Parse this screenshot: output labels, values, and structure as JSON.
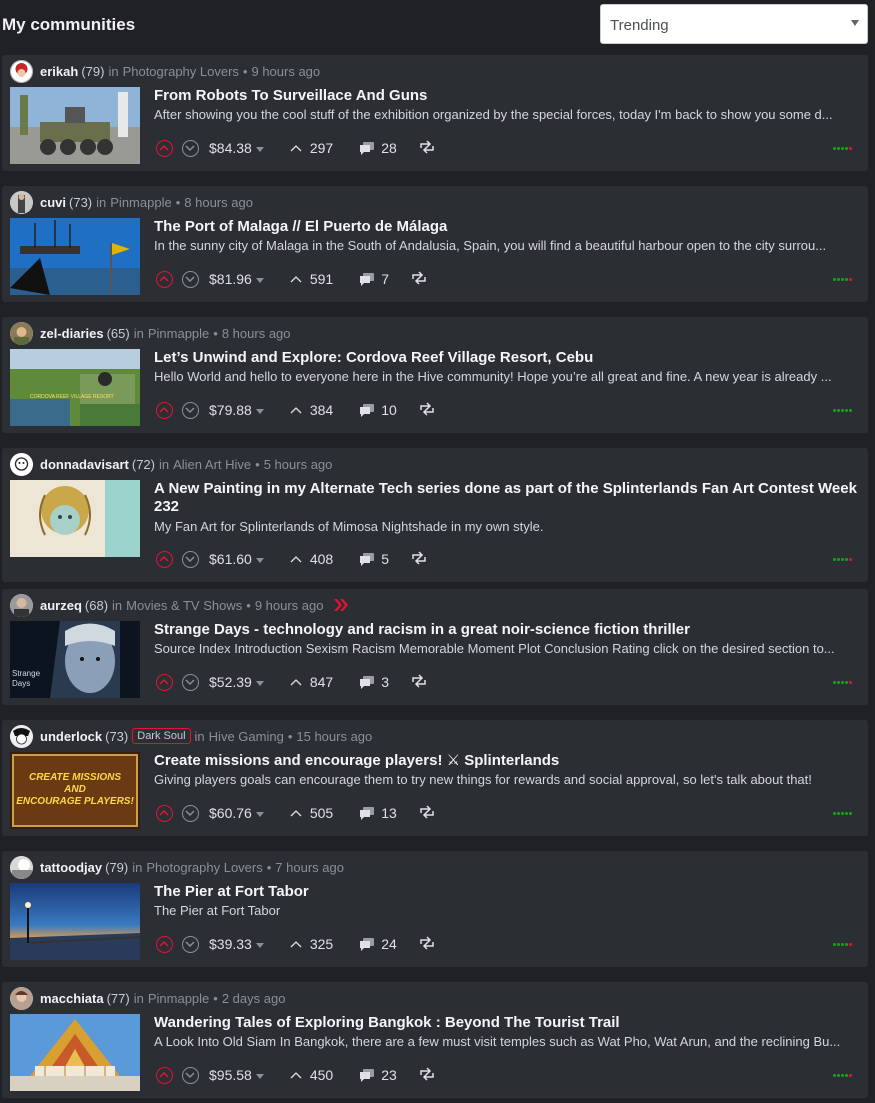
{
  "header": {
    "title": "My communities",
    "sort_value": "Trending"
  },
  "posts": [
    {
      "author": "erikah",
      "rep": "(79)",
      "in": "in",
      "community": "Photography Lovers",
      "time": "9 hours ago",
      "title": "From Robots To Surveillace And Guns",
      "summary": "After showing you the cool stuff of the exhibition organized by the special forces, today I'm back to show you some d...",
      "payout": "$84.38",
      "votes": "297",
      "comments": "28",
      "badge": ""
    },
    {
      "author": "cuvi",
      "rep": "(73)",
      "in": "in",
      "community": "Pinmapple",
      "time": "8 hours ago",
      "title": "The Port of Malaga // El Puerto de Málaga",
      "summary": "In the sunny city of Malaga in the South of Andalusia, Spain, you will find a beautiful harbour open to the city surrou...",
      "payout": "$81.96",
      "votes": "591",
      "comments": "7",
      "badge": ""
    },
    {
      "author": "zel-diaries",
      "rep": "(65)",
      "in": "in",
      "community": "Pinmapple",
      "time": "8 hours ago",
      "title": "Let’s Unwind and Explore: Cordova Reef Village Resort, Cebu",
      "summary": "Hello World and hello to everyone here in the Hive community! Hope you’re all great and fine. A new year is already ...",
      "payout": "$79.88",
      "votes": "384",
      "comments": "10",
      "badge": ""
    },
    {
      "author": "donnadavisart",
      "rep": "(72)",
      "in": "in",
      "community": "Alien Art Hive",
      "time": "5 hours ago",
      "title": "A New Painting in my Alternate Tech series done as part of the Splinterlands Fan Art Contest Week 232",
      "summary": "My Fan Art for Splinterlands of Mimosa Nightshade in my own style.",
      "payout": "$61.60",
      "votes": "408",
      "comments": "5",
      "badge": ""
    },
    {
      "author": "aurzeq",
      "rep": "(68)",
      "in": "in",
      "community": "Movies & TV Shows",
      "time": "9 hours ago",
      "title": "Strange Days - technology and racism in a great noir-science fiction thriller",
      "summary": "Source Index Introduction Sexism Racism Memorable Moment Plot Conclusion Rating click on the desired section to...",
      "payout": "$52.39",
      "votes": "847",
      "comments": "3",
      "badge": ""
    },
    {
      "author": "underlock",
      "rep": "(73)",
      "in": "in",
      "community": "Hive Gaming",
      "time": "15 hours ago",
      "title": "Create missions and encourage players! ⚔ Splinterlands",
      "summary": "Giving players goals can encourage them to try new things for rewards and social approval, so let's talk about that!",
      "payout": "$60.76",
      "votes": "505",
      "comments": "13",
      "badge": "Dark Soul"
    },
    {
      "author": "tattoodjay",
      "rep": "(79)",
      "in": "in",
      "community": "Photography Lovers",
      "time": "7 hours ago",
      "title": "The Pier at Fort Tabor",
      "summary": "The Pier at Fort Tabor",
      "payout": "$39.33",
      "votes": "325",
      "comments": "24",
      "badge": ""
    },
    {
      "author": "macchiata",
      "rep": "(77)",
      "in": "in",
      "community": "Pinmapple",
      "time": "2 days ago",
      "title": "Wandering Tales of Exploring Bangkok : Beyond The Tourist Trail",
      "summary": "A Look Into Old Siam In Bangkok, there are a few must visit temples such as Wat Pho, Wat Arun, and the reclining Bu...",
      "payout": "$95.58",
      "votes": "450",
      "comments": "23",
      "badge": ""
    }
  ],
  "thumb_text": {
    "strange_days": "Strange\nDays",
    "missions": "CREATE MISSIONS AND ENCOURAGE PLAYERS!",
    "resort": "CORDOVA REEF VILLAGE RESORT"
  },
  "colors": {
    "accent": "#e31337",
    "card": "#2b2e33",
    "bg": "#1f2125"
  }
}
